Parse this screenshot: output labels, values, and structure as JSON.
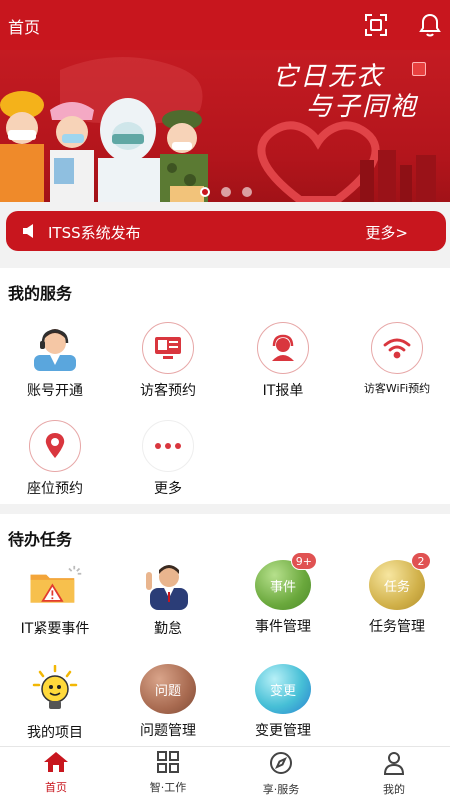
{
  "header": {
    "title": "首页",
    "scan_icon": "scan-icon",
    "bell_icon": "bell-icon"
  },
  "banner": {
    "slogan_line1": "它日无衣",
    "slogan_line2": "与子同袍",
    "slide_count": 3,
    "active_slide": 1
  },
  "notice": {
    "text": "ITSS系统发布",
    "more": "更多>"
  },
  "services": {
    "title": "我的服务",
    "items": [
      {
        "label": "账号开通",
        "icon": "support-agent-icon"
      },
      {
        "label": "访客预约",
        "icon": "visitor-monitor-icon"
      },
      {
        "label": "IT报单",
        "icon": "headset-operator-icon"
      },
      {
        "label": "访客WiFi预约",
        "icon": "wifi-icon"
      },
      {
        "label": "座位预约",
        "icon": "location-pin-icon"
      },
      {
        "label": "更多",
        "icon": "more-dots-icon"
      }
    ]
  },
  "tasks": {
    "title": "待办任务",
    "items": [
      {
        "label": "IT紧要事件",
        "icon": "warning-folder-icon"
      },
      {
        "label": "勤怠",
        "icon": "attendance-person-icon"
      },
      {
        "label": "事件管理",
        "ball_text": "事件",
        "badge": "9+"
      },
      {
        "label": "任务管理",
        "ball_text": "任务",
        "badge": "2"
      },
      {
        "label": "我的项目",
        "icon": "lightbulb-icon"
      },
      {
        "label": "问题管理",
        "ball_text": "问题"
      },
      {
        "label": "变更管理",
        "ball_text": "变更"
      }
    ]
  },
  "tabbar": {
    "active": 0,
    "items": [
      {
        "label": "首页",
        "icon": "home-icon"
      },
      {
        "label": "智·工作",
        "icon": "grid-icon"
      },
      {
        "label": "享·服务",
        "icon": "compass-icon"
      },
      {
        "label": "我的",
        "icon": "user-icon"
      }
    ]
  },
  "colors": {
    "brand_red": "#c8161e",
    "badge_red": "#e05252"
  }
}
